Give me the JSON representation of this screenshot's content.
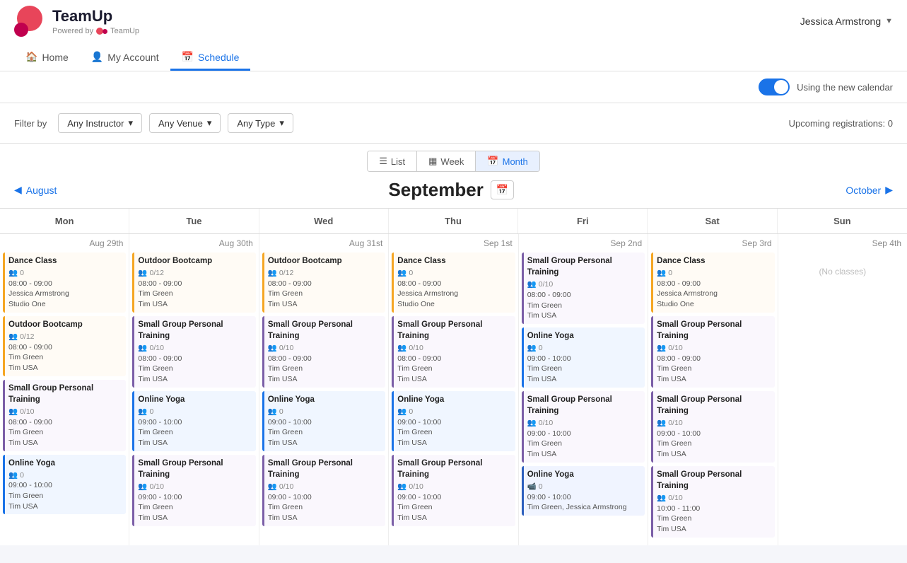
{
  "header": {
    "logo_text": "TeamUp",
    "powered_by": "Powered by",
    "powered_name": "TeamUp",
    "user_name": "Jessica Armstrong",
    "user_chevron": "▼"
  },
  "nav": {
    "items": [
      {
        "label": "Home",
        "icon": "🏠",
        "active": false
      },
      {
        "label": "My Account",
        "icon": "👤",
        "active": false
      },
      {
        "label": "Schedule",
        "icon": "📅",
        "active": true
      }
    ]
  },
  "toggle": {
    "label": "Using the new calendar"
  },
  "filters": {
    "label": "Filter by",
    "instructor": "Any Instructor",
    "venue": "Any Venue",
    "type": "Any Type",
    "upcoming": "Upcoming registrations: 0"
  },
  "views": {
    "list": "List",
    "week": "Week",
    "month": "Month",
    "active": "Month"
  },
  "calendar": {
    "prev_month": "August",
    "next_month": "October",
    "current_month": "September",
    "day_headers": [
      "Mon",
      "Tue",
      "Wed",
      "Thu",
      "Fri",
      "Sat",
      "Sun"
    ],
    "weeks": [
      {
        "days": [
          {
            "date": "Aug 29th",
            "events": [
              {
                "title": "Dance Class",
                "color": "orange",
                "time": "08:00 - 09:00",
                "instructor": "Jessica Armstrong",
                "venue": "Studio One",
                "capacity": "0",
                "type": "people"
              },
              {
                "title": "Outdoor Bootcamp",
                "color": "orange",
                "time": "08:00 - 09:00",
                "instructor": "Tim Green",
                "venue": "Tim USA",
                "capacity": "0/12",
                "type": "people"
              },
              {
                "title": "Small Group Personal Training",
                "color": "purple",
                "time": "08:00 - 09:00",
                "instructor": "Tim Green",
                "venue": "Tim USA",
                "capacity": "0/10",
                "type": "people"
              },
              {
                "title": "Online Yoga",
                "color": "blue",
                "time": "09:00 - 10:00",
                "instructor": "Tim Green",
                "venue": "Tim USA",
                "capacity": "0",
                "type": "people"
              }
            ]
          },
          {
            "date": "Aug 30th",
            "events": [
              {
                "title": "Outdoor Bootcamp",
                "color": "orange",
                "time": "08:00 - 09:00",
                "instructor": "Tim Green",
                "venue": "Tim USA",
                "capacity": "0/12",
                "type": "people"
              },
              {
                "title": "Small Group Personal Training",
                "color": "purple",
                "time": "08:00 - 09:00",
                "instructor": "Tim Green",
                "venue": "Tim USA",
                "capacity": "0/10",
                "type": "people"
              },
              {
                "title": "Online Yoga",
                "color": "blue",
                "time": "09:00 - 10:00",
                "instructor": "Tim Green",
                "venue": "Tim USA",
                "capacity": "0",
                "type": "people"
              },
              {
                "title": "Small Group Personal Training",
                "color": "purple",
                "time": "09:00 - 10:00",
                "instructor": "Tim Green",
                "venue": "Tim USA",
                "capacity": "0/10",
                "type": "people"
              }
            ]
          },
          {
            "date": "Aug 31st",
            "events": [
              {
                "title": "Outdoor Bootcamp",
                "color": "orange",
                "time": "08:00 - 09:00",
                "instructor": "Tim Green",
                "venue": "Tim USA",
                "capacity": "0/12",
                "type": "people"
              },
              {
                "title": "Small Group Personal Training",
                "color": "purple",
                "time": "08:00 - 09:00",
                "instructor": "Tim Green",
                "venue": "Tim USA",
                "capacity": "0/10",
                "type": "people"
              },
              {
                "title": "Online Yoga",
                "color": "blue",
                "time": "09:00 - 10:00",
                "instructor": "Tim Green",
                "venue": "Tim USA",
                "capacity": "0",
                "type": "people"
              },
              {
                "title": "Small Group Personal Training",
                "color": "purple",
                "time": "09:00 - 10:00",
                "instructor": "Tim Green",
                "venue": "Tim USA",
                "capacity": "0/10",
                "type": "people"
              }
            ]
          },
          {
            "date": "Sep 1st",
            "events": [
              {
                "title": "Dance Class",
                "color": "orange",
                "time": "08:00 - 09:00",
                "instructor": "Jessica Armstrong",
                "venue": "Studio One",
                "capacity": "0",
                "type": "people"
              },
              {
                "title": "Small Group Personal Training",
                "color": "purple",
                "time": "08:00 - 09:00",
                "instructor": "Tim Green",
                "venue": "Tim USA",
                "capacity": "0/10",
                "type": "people"
              },
              {
                "title": "Online Yoga",
                "color": "blue",
                "time": "09:00 - 10:00",
                "instructor": "Tim Green",
                "venue": "Tim USA",
                "capacity": "0",
                "type": "people"
              },
              {
                "title": "Small Group Personal Training",
                "color": "purple",
                "time": "09:00 - 10:00",
                "instructor": "Tim Green",
                "venue": "Tim USA",
                "capacity": "0/10",
                "type": "people"
              }
            ]
          },
          {
            "date": "Sep 2nd",
            "events": [
              {
                "title": "Small Group Personal Training",
                "color": "purple",
                "time": "08:00 - 09:00",
                "instructor": "Tim Green",
                "venue": "Tim USA",
                "capacity": "0/10",
                "type": "people"
              },
              {
                "title": "Online Yoga",
                "color": "blue",
                "time": "09:00 - 10:00",
                "instructor": "Tim Green",
                "venue": "Tim USA",
                "capacity": "0",
                "type": "people"
              },
              {
                "title": "Small Group Personal Training",
                "color": "purple",
                "time": "09:00 - 10:00",
                "instructor": "Tim Green",
                "venue": "Tim USA",
                "capacity": "0/10",
                "type": "people"
              },
              {
                "title": "Online Yoga",
                "color": "dark-blue",
                "time": "09:00 - 10:00",
                "instructor": "Tim Green, Jessica Armstrong",
                "venue": "",
                "capacity": "0",
                "type": "video"
              }
            ]
          },
          {
            "date": "Sep 3rd",
            "events": [
              {
                "title": "Dance Class",
                "color": "orange",
                "time": "08:00 - 09:00",
                "instructor": "Jessica Armstrong",
                "venue": "Studio One",
                "capacity": "0",
                "type": "people"
              },
              {
                "title": "Small Group Personal Training",
                "color": "purple",
                "time": "08:00 - 09:00",
                "instructor": "Tim Green",
                "venue": "Tim USA",
                "capacity": "0/10",
                "type": "people"
              },
              {
                "title": "Small Group Personal Training",
                "color": "purple",
                "time": "09:00 - 10:00",
                "instructor": "Tim Green",
                "venue": "Tim USA",
                "capacity": "0/10",
                "type": "people"
              },
              {
                "title": "Small Group Personal Training",
                "color": "purple",
                "time": "10:00 - 11:00",
                "instructor": "Tim Green",
                "venue": "Tim USA",
                "capacity": "0/10",
                "type": "people"
              }
            ]
          },
          {
            "date": "Sep 4th",
            "events": [],
            "no_classes": "(No classes)"
          }
        ]
      }
    ]
  }
}
